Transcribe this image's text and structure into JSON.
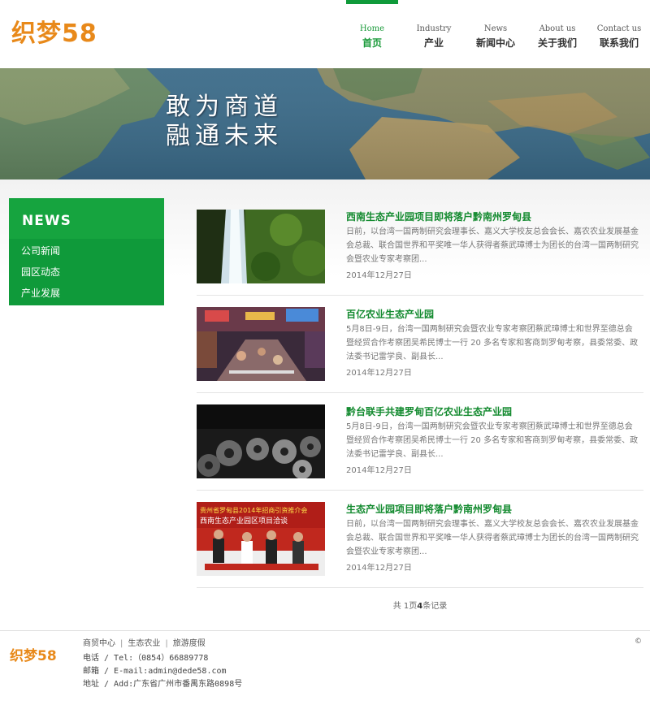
{
  "header": {
    "logo": "织梦58"
  },
  "nav": [
    {
      "en": "Home",
      "cn": "首页"
    },
    {
      "en": "Industry",
      "cn": "产业"
    },
    {
      "en": "News",
      "cn": "新闻中心"
    },
    {
      "en": "About us",
      "cn": "关于我们"
    },
    {
      "en": "Contact us",
      "cn": "联系我们"
    }
  ],
  "banner": {
    "line1": "敢为商道",
    "line2": "融通未来"
  },
  "sidebar": {
    "title": "NEWS",
    "items": [
      "公司新闻",
      "园区动态",
      "产业发展"
    ]
  },
  "news": [
    {
      "title": "西南生态产业园项目即将落户黔南州罗甸县",
      "desc": "日前，以台湾一国两制研究会理事长、嘉义大学校友总会会长、嘉农农业发展基金会总裁、联合国世界和平奖唯一华人获得者蔡武璋博士为团长的台湾一国两制研究会暨农业专家考察团...",
      "date": "2014年12月27日",
      "thumb": "waterfall"
    },
    {
      "title": "百亿农业生态产业园",
      "desc": "5月8日-9日，台湾一国两制研究会暨农业专家考察团蔡武璋博士和世界至德总会暨经贸合作考察团吴希民博士一行 20 多名专家和客商到罗甸考察，县委常委、政法委书记雷学良、副县长...",
      "date": "2014年12月27日",
      "thumb": "street"
    },
    {
      "title": "黔台联手共建罗甸百亿农业生态产业园",
      "desc": "5月8日-9日，台湾一国两制研究会暨农业专家考察团蔡武璋博士和世界至德总会暨经贸合作考察团吴希民博士一行 20 多名专家和客商到罗甸考察，县委常委、政法委书记雷学良、副县长...",
      "date": "2014年12月27日",
      "thumb": "rolls"
    },
    {
      "title": "生态产业园项目即将落户黔南州罗甸县",
      "desc": "日前，以台湾一国两制研究会理事长、嘉义大学校友总会会长、嘉农农业发展基金会总裁、联合国世界和平奖唯一华人获得者蔡武璋博士为团长的台湾一国两制研究会暨农业专家考察团...",
      "date": "2014年12月27日",
      "thumb": "ceremony"
    }
  ],
  "ceremony_banner": {
    "line1": "贵州省罗甸县2014年招商引资推介会",
    "line2": "西南生态产业园区项目洽谈"
  },
  "pager": {
    "prefix": "共",
    "pages": "1",
    "mid": "页",
    "records": "4",
    "suffix": "条记录"
  },
  "footer": {
    "logo": "织梦58",
    "links": [
      "商贸中心",
      "生态农业",
      "旅游度假"
    ],
    "phone": "电话 / Tel:（0854）66889778",
    "email": "邮箱 / E-mail:admin@dede58.com",
    "address": "地址 / Add:广东省广州市番禺东路0898号",
    "copyright": "©"
  },
  "colors": {
    "brand_green": "#0f9a3a",
    "title_green": "#138a2f",
    "logo_orange": "#e8891a"
  }
}
